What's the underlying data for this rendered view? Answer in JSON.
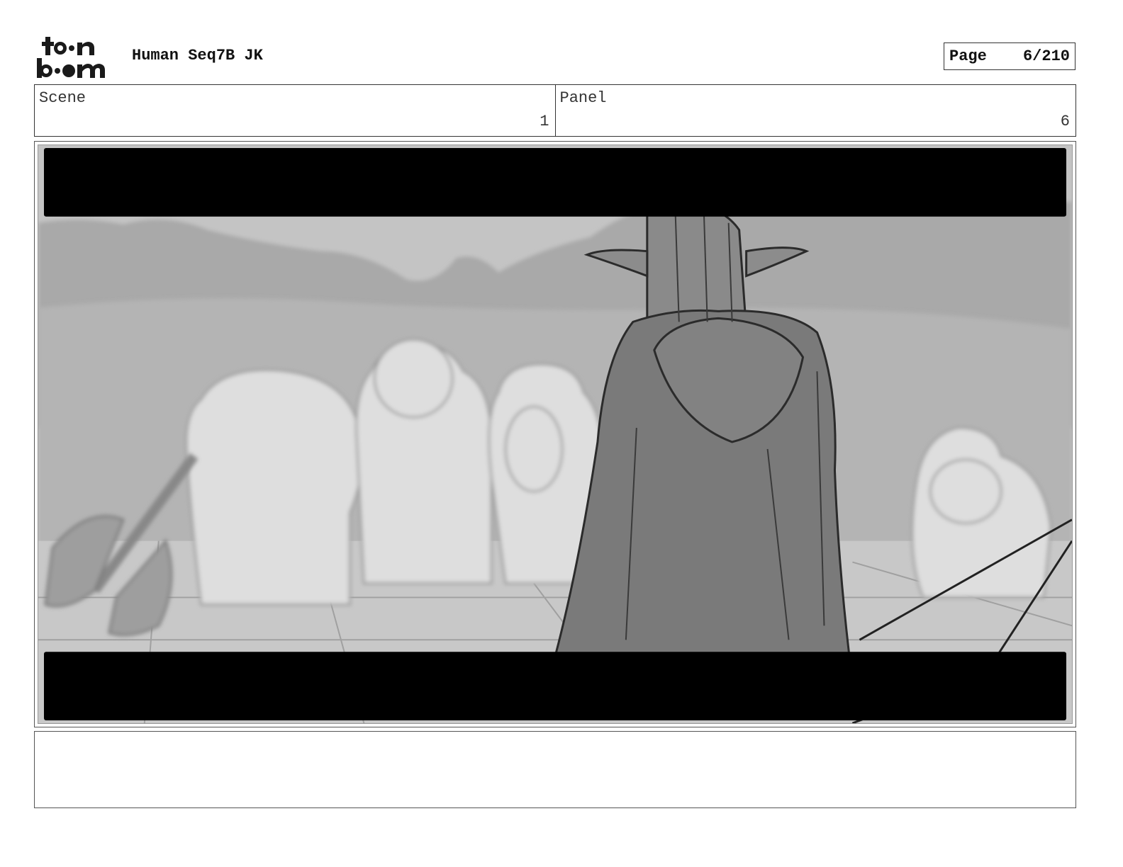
{
  "header": {
    "logo_text": "toon boom",
    "title": "Human Seq7B JK",
    "page_label": "Page",
    "page_value": "6/210"
  },
  "info": {
    "scene_label": "Scene",
    "scene_value": "1",
    "panel_label": "Panel",
    "panel_value": "6"
  },
  "panel": {
    "image": "storyboard-sketch",
    "letterbox_color": "#000000"
  },
  "notes": {
    "text": ""
  }
}
